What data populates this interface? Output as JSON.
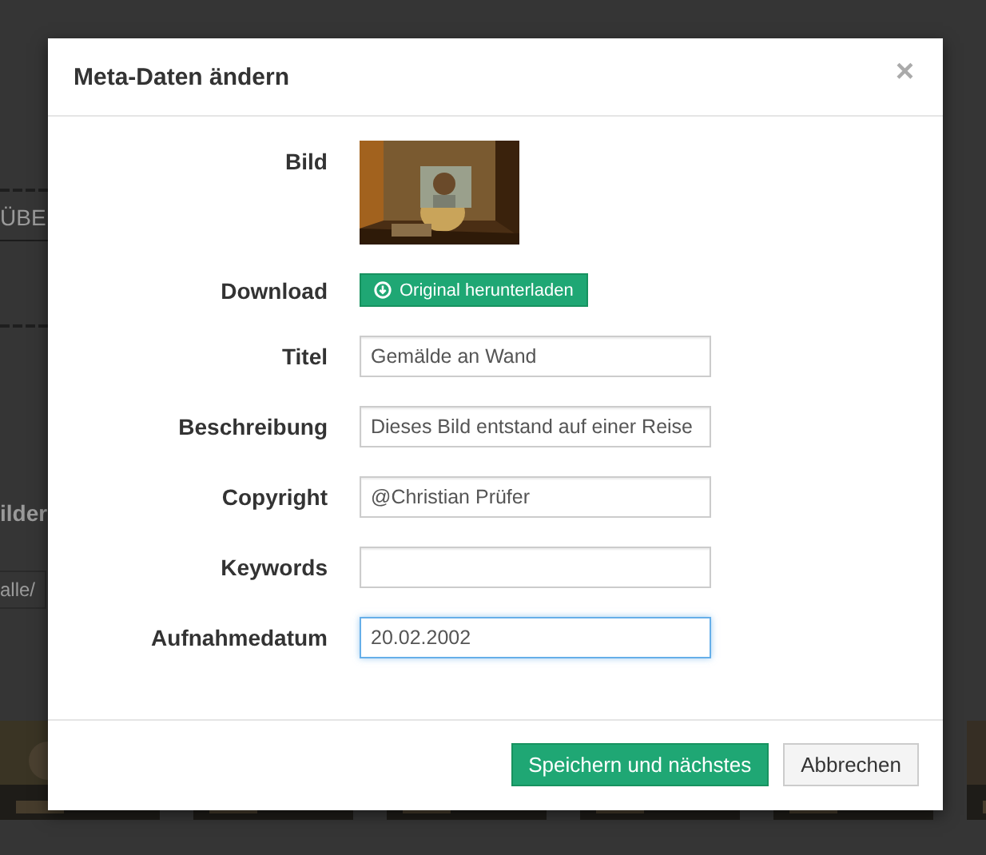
{
  "page": {
    "tab_label": "ÜBE",
    "heading": "ilder",
    "filter_value": "alle/"
  },
  "dialog": {
    "title": "Meta-Daten ändern",
    "close": "×",
    "rows": [
      {
        "label": "Bild"
      },
      {
        "kind": "button",
        "label": "Download",
        "button": "Original herunterladen"
      },
      {
        "kind": "text",
        "label": "Titel",
        "value": "Gemälde an Wand",
        "focused": false
      },
      {
        "kind": "text",
        "label": "Beschreibung",
        "value": "Dieses Bild entstand auf einer Reise",
        "focused": false
      },
      {
        "kind": "text",
        "label": "Copyright",
        "value": "@Christian Prüfer",
        "focused": false
      },
      {
        "kind": "text",
        "label": "Keywords",
        "focused": false
      },
      {
        "kind": "text",
        "label": "Aufnahmedatum",
        "value": "20.02.2002",
        "focused": true
      }
    ],
    "buttons": [
      {
        "label": "Speichern und nächstes",
        "primary": true
      },
      {
        "label": "Abbrechen",
        "primary": false
      }
    ]
  }
}
